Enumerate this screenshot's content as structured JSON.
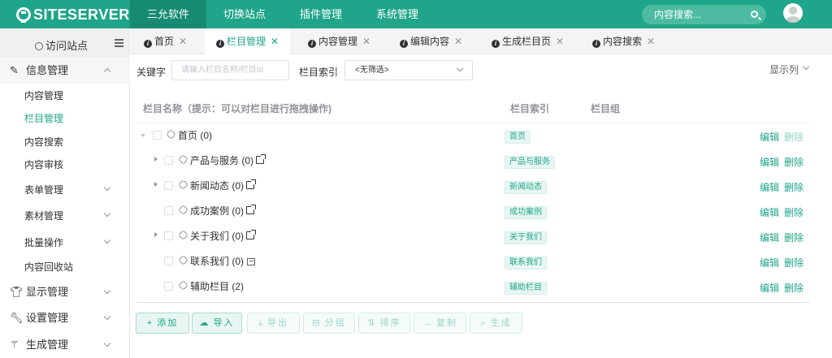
{
  "app": {
    "logo_text": "SITESERVER"
  },
  "topnav": {
    "items": [
      "三允软件",
      "切换站点",
      "插件管理",
      "系统管理"
    ],
    "search_placeholder": "内容搜索..."
  },
  "sidebar": {
    "visit_site": "访问站点",
    "groups": {
      "info": {
        "label": "信息管理",
        "icon": "edit-icon"
      },
      "display": {
        "label": "显示管理",
        "icon": "shirt-icon"
      },
      "settings": {
        "label": "设置管理",
        "icon": "wrench-icon"
      },
      "generate": {
        "label": "生成管理",
        "icon": "magic-wand-icon"
      }
    },
    "items": [
      "内容管理",
      "栏目管理",
      "内容搜索",
      "内容审核",
      "表单管理",
      "素材管理",
      "批量操作",
      "内容回收站"
    ]
  },
  "tabs": [
    "首页",
    "栏目管理",
    "内容管理",
    "编辑内容",
    "生成栏目页",
    "内容搜索"
  ],
  "filter": {
    "keyword_label": "关键字",
    "keyword_placeholder": "请输入栏目名称/栏目Id",
    "index_label": "栏目索引",
    "index_value": "<无筛选>",
    "show_columns": "显示列"
  },
  "table": {
    "headers": [
      "栏目名称（提示：可以对栏目进行拖拽操作)",
      "栏目索引",
      "栏目组"
    ],
    "rows": [
      {
        "name": "首页 (0)",
        "tag": "首页",
        "edit": "编辑",
        "delete": "删除"
      },
      {
        "name": "产品与服务 (0)",
        "tag": "产品与服务",
        "edit": "编辑",
        "delete": "删除"
      },
      {
        "name": "新闻动态 (0)",
        "tag": "新闻动态",
        "edit": "编辑",
        "delete": "删除"
      },
      {
        "name": "成功案例 (0)",
        "tag": "成功案例",
        "edit": "编辑",
        "delete": "删除"
      },
      {
        "name": "关于我们 (0)",
        "tag": "关于我们",
        "edit": "编辑",
        "delete": "删除"
      },
      {
        "name": "联系我们 (0)",
        "tag": "联系我们",
        "edit": "编辑",
        "delete": "删除"
      },
      {
        "name": "辅助栏目 (2)",
        "tag": "辅助栏目",
        "edit": "编辑",
        "delete": "删除"
      }
    ]
  },
  "buttons": [
    "添加",
    "导入",
    "导出",
    "分组",
    "排序",
    "复制",
    "生成"
  ],
  "colors": {
    "brand": "#1fa58a",
    "brand_dark": "#168a72"
  }
}
